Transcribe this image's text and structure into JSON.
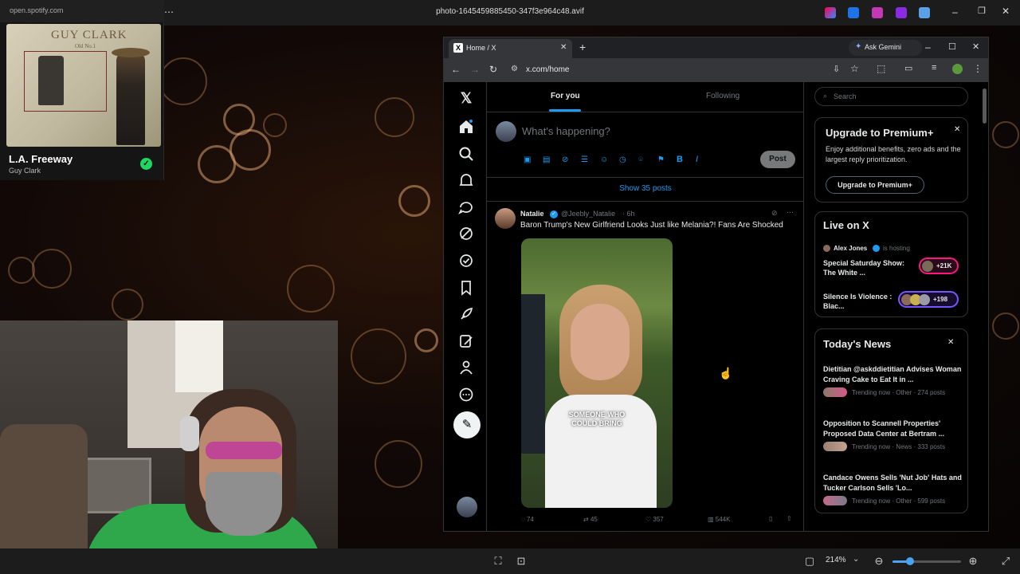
{
  "viewer": {
    "title": "photo-1645459885450-347f3e964c48.avif",
    "zoom": "214%",
    "zoom_level": 0.25
  },
  "spotify": {
    "url": "open.spotify.com",
    "song": "L.A. Freeway",
    "artist": "Guy Clark",
    "album_art_text": "GUY CLARK",
    "album_art_sub": "Old No.1"
  },
  "browser": {
    "tab_title": "Home / X",
    "url": "x.com/home",
    "gemini_label": "Ask Gemini"
  },
  "x": {
    "tabs": [
      "For you",
      "Following"
    ],
    "compose_placeholder": "What's happening?",
    "post_button": "Post",
    "show_posts": "Show 35 posts",
    "tweet": {
      "author": "Natalie",
      "handle": "@Jeebly_Natalie",
      "time": "· 6h",
      "text": "Baron Trump's New Girlfriend Looks Just like Melania?! Fans Are Shocked",
      "caption_line1": "SOMEONE WHO",
      "caption_line2": "COULD BRING",
      "replies": "74",
      "reposts": "45",
      "likes": "357",
      "views": "544K"
    },
    "search_placeholder": "Search",
    "premium": {
      "title": "Upgrade to Premium+",
      "body": "Enjoy additional benefits, zero ads and the largest reply prioritization.",
      "button": "Upgrade to Premium+"
    },
    "live": {
      "title": "Live on X",
      "host": "Alex Jones",
      "host_status": "is hosting",
      "items": [
        {
          "title": "Special Saturday Show: The White ...",
          "count": "+21K"
        },
        {
          "title": "Silence Is Violence : Blac...",
          "count": "+198"
        }
      ]
    },
    "news": {
      "title": "Today's News",
      "items": [
        {
          "title": "Dietitian @askddietitian Advises Woman Craving Cake to Eat It in ...",
          "meta": "Trending now · Other · 274 posts"
        },
        {
          "title": "Opposition to Scannell Properties' Proposed Data Center at Bertram ...",
          "meta": "Trending now · News · 333 posts"
        },
        {
          "title": "Candace Owens Sells 'Nut Job' Hats and Tucker Carlson Sells 'Lo...",
          "meta": "Trending now · Other · 599 posts"
        }
      ]
    }
  }
}
